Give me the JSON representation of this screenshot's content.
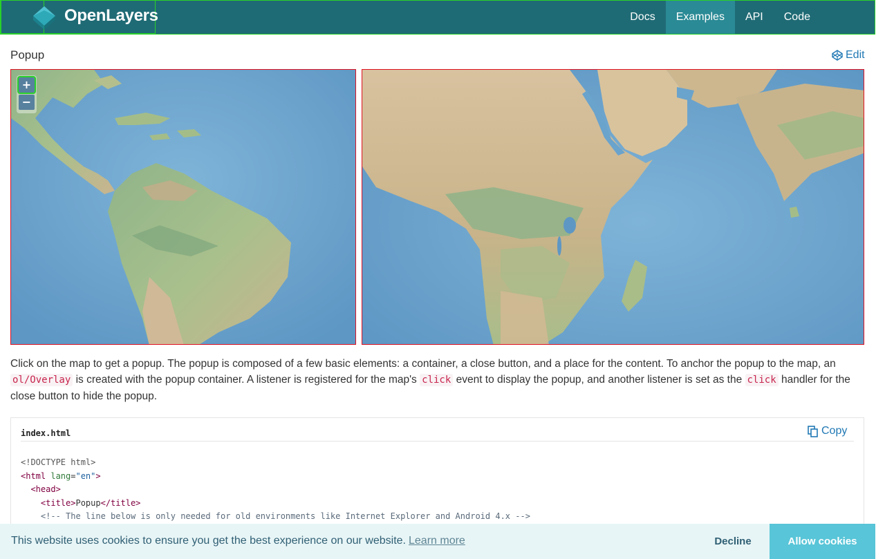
{
  "header": {
    "brand": "OpenLayers",
    "nav": [
      {
        "label": "Docs",
        "active": false
      },
      {
        "label": "Examples",
        "active": true
      },
      {
        "label": "API",
        "active": false
      },
      {
        "label": "Code",
        "active": false
      }
    ]
  },
  "page": {
    "title": "Popup",
    "edit_label": "Edit"
  },
  "map": {
    "zoom_in": "+",
    "zoom_out": "−"
  },
  "description": {
    "part1": "Click on the map to get a popup. The popup is composed of a few basic elements: a container, a close button, and a place for the content. To anchor the popup to the map, an ",
    "code1": "ol/Overlay",
    "part2": " is created with the popup container. A listener is registered for the map's ",
    "code2": "click",
    "part3": " event to display the popup, and another listener is set as the ",
    "code3": "click",
    "part4": " handler for the close button to hide the popup."
  },
  "code_box": {
    "filename": "index.html",
    "copy_label": "Copy",
    "lines": {
      "l1": "<!DOCTYPE html>",
      "l2_open": "<html",
      "l2_attr": " lang",
      "l2_eq": "=",
      "l2_val": "\"en\"",
      "l2_close": ">",
      "l3": "<head>",
      "l4_open": "<title>",
      "l4_text": "Popup",
      "l4_close": "</title>",
      "l5": "<!-- The line below is only needed for old environments like Internet Explorer and Android 4.x -->"
    }
  },
  "cookie": {
    "message": "This website uses cookies to ensure you get the best experience on our website.",
    "learn_more": "Learn more",
    "decline": "Decline",
    "allow": "Allow cookies"
  },
  "colors": {
    "header_bg": "#1f6b75",
    "active_tab": "#2a8a95",
    "accent_link": "#1f78b4",
    "allow_button": "#58c5d8"
  }
}
